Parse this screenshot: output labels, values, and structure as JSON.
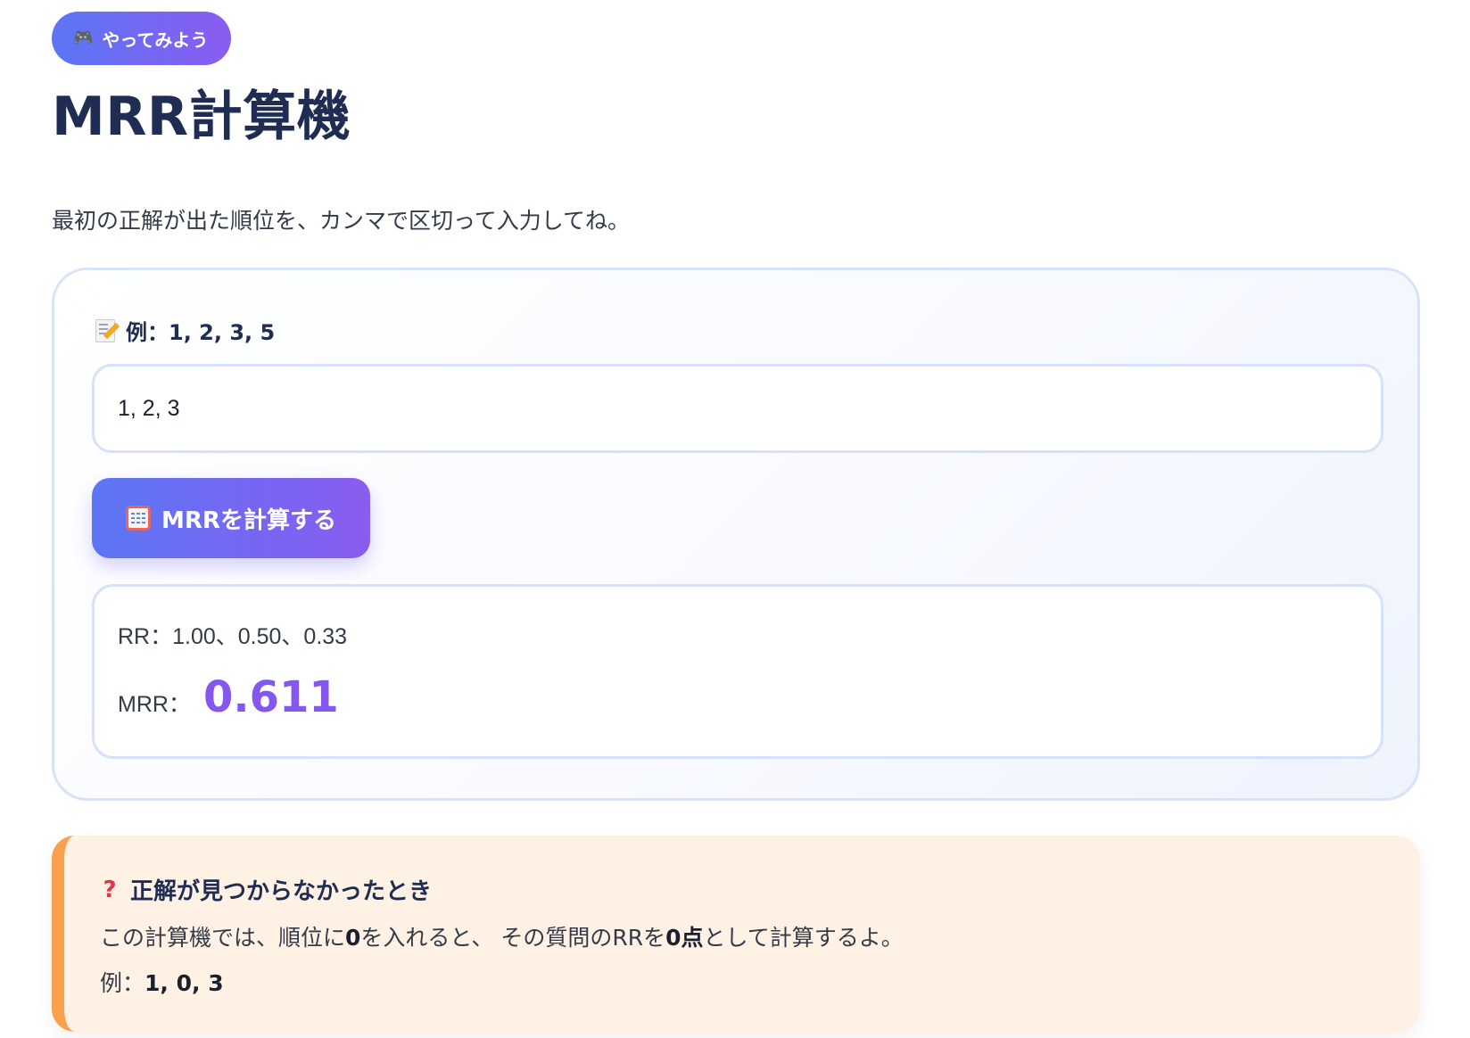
{
  "badge": {
    "icon": "game-controller-icon",
    "label": "やってみよう"
  },
  "title": "MRR計算機",
  "subtitle": "最初の正解が出た順位を、カンマで区切って入力してね。",
  "calculator": {
    "example_icon": "memo-icon",
    "example_prefix": "例：",
    "example_value": "1, 2, 3, 5",
    "input_value": "1, 2, 3",
    "button_icon": "abacus-icon",
    "button_label": "MRRを計算する",
    "result": {
      "rr_label": "RR：",
      "rr_values": "1.00、0.50、0.33",
      "mrr_label": "MRR：",
      "mrr_value": "0.611"
    }
  },
  "note": {
    "icon": "question-mark-icon",
    "title": "正解が見つからなかったとき",
    "text_part1": "この計算機では、順位に",
    "text_bold1": "0",
    "text_part2": "を入れると、 その質問のRRを",
    "text_bold2": "0点",
    "text_part3": "として計算するよ。",
    "example_prefix": "例：",
    "example_value": "1, 0, 3"
  },
  "colors": {
    "accent_start": "#5b76f5",
    "accent_end": "#8a5cf0",
    "mrr_value": "#8458ee",
    "note_border": "#f8a04c",
    "note_bg": "#fff2e5",
    "title": "#1f2d52"
  }
}
